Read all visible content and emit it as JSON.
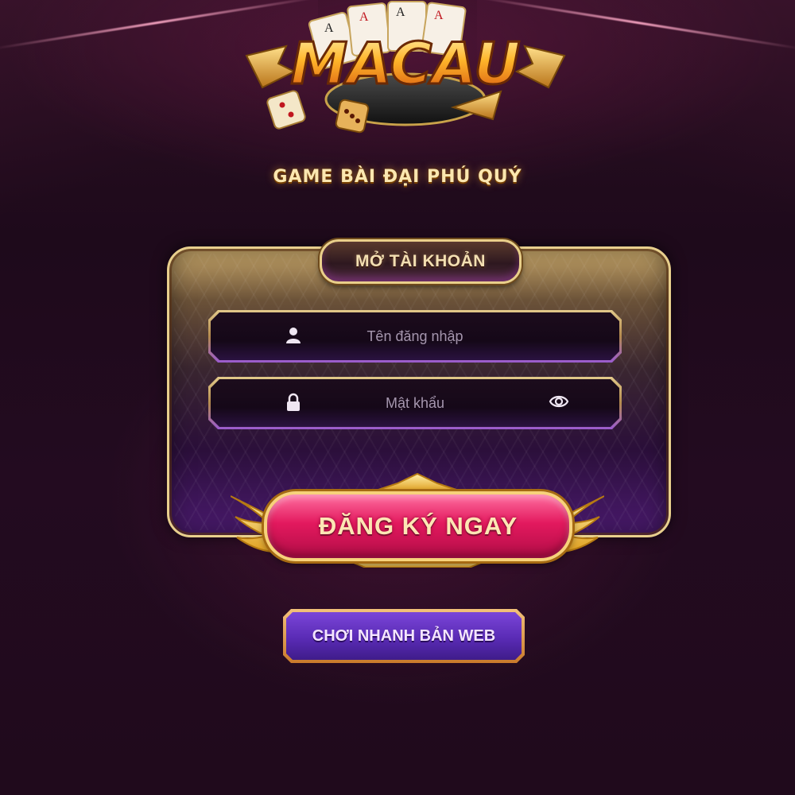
{
  "logo": {
    "text": "MACAU"
  },
  "tagline": "GAME BÀI ĐẠI PHÚ QUÝ",
  "form": {
    "title": "MỞ TÀI KHOẢN",
    "username_placeholder": "Tên đăng nhập",
    "password_placeholder": "Mật khẩu",
    "register_label": "ĐĂNG KÝ NGAY"
  },
  "web_button_label": "CHƠI NHANH BẢN WEB",
  "icons": {
    "username": "user-icon",
    "password": "lock-icon",
    "toggle_password": "eye-icon"
  },
  "colors": {
    "accent_gold": "#e8cf8d",
    "register_pink": "#e3195e",
    "web_purple": "#5a2bb5",
    "background": "#1e0a1b"
  }
}
